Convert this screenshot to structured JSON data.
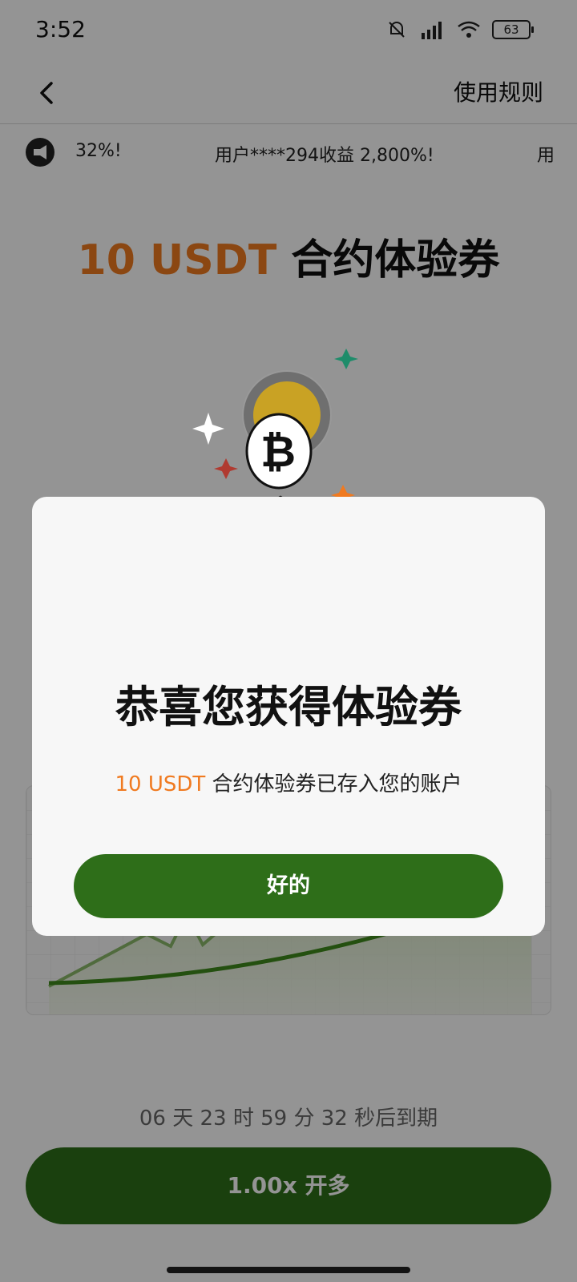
{
  "status_bar": {
    "time": "3:52",
    "battery": "63"
  },
  "header": {
    "rules_label": "使用规则"
  },
  "ticker": {
    "left_fragment": "32%!",
    "main": "用户****294收益 2,800%!",
    "right_fragment": "用"
  },
  "hero": {
    "amount": "10 USDT",
    "title": " 合约体验券"
  },
  "background": {
    "expiry": "06 天 23 时 59 分 32 秒后到期",
    "open_long": "1.00x 开多"
  },
  "dialog": {
    "title": "恭喜您获得体验券",
    "sub_amount": "10 USDT",
    "sub_text": " 合约体验券已存入您的账户",
    "ok_label": "好的"
  },
  "icons": {
    "back": "chevron-left-icon",
    "megaphone": "megaphone-icon",
    "bitcoin": "bitcoin-coin-icon",
    "check": "check-icon"
  },
  "colors": {
    "accent": "#f07a20",
    "primary_button": "#2e6e19"
  }
}
